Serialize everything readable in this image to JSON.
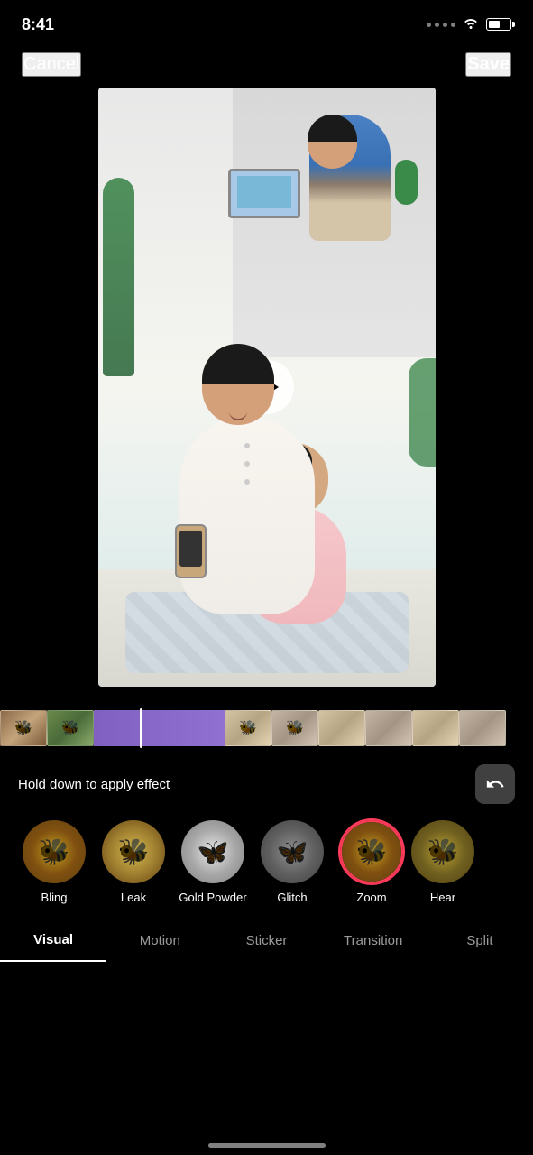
{
  "statusBar": {
    "time": "8:41",
    "battery": 55
  },
  "header": {
    "cancelLabel": "Cancel",
    "saveLabel": "Save"
  },
  "video": {
    "playButtonAlt": "Play video"
  },
  "controls": {
    "holdInstruction": "Hold down to apply effect",
    "undoLabel": "↺"
  },
  "effects": [
    {
      "id": "bling",
      "label": "Bling",
      "thumbClass": "thumb-bling",
      "selected": false
    },
    {
      "id": "leak",
      "label": "Leak",
      "thumbClass": "thumb-leak",
      "selected": false
    },
    {
      "id": "goldpowder",
      "label": "Gold Powder",
      "thumbClass": "thumb-goldpowder",
      "selected": false
    },
    {
      "id": "glitch",
      "label": "Glitch",
      "thumbClass": "thumb-glitch",
      "selected": false
    },
    {
      "id": "zoom",
      "label": "Zoom",
      "thumbClass": "thumb-zoom",
      "selected": true
    },
    {
      "id": "hear",
      "label": "Hear",
      "thumbClass": "thumb-hear",
      "selected": false
    }
  ],
  "categories": [
    {
      "id": "visual",
      "label": "Visual",
      "active": true
    },
    {
      "id": "motion",
      "label": "Motion",
      "active": false
    },
    {
      "id": "sticker",
      "label": "Sticker",
      "active": false
    },
    {
      "id": "transition",
      "label": "Transition",
      "active": false
    },
    {
      "id": "split",
      "label": "Split",
      "active": false
    }
  ],
  "timeline": {
    "frames": [
      {
        "class": "frame-1"
      },
      {
        "class": "frame-2"
      },
      {
        "class": "frame-purple"
      },
      {
        "class": "frame-purple"
      },
      {
        "class": "frame-3"
      },
      {
        "class": "frame-4"
      },
      {
        "class": "frame-3"
      },
      {
        "class": "frame-4"
      },
      {
        "class": "frame-3"
      },
      {
        "class": "frame-4"
      }
    ]
  }
}
